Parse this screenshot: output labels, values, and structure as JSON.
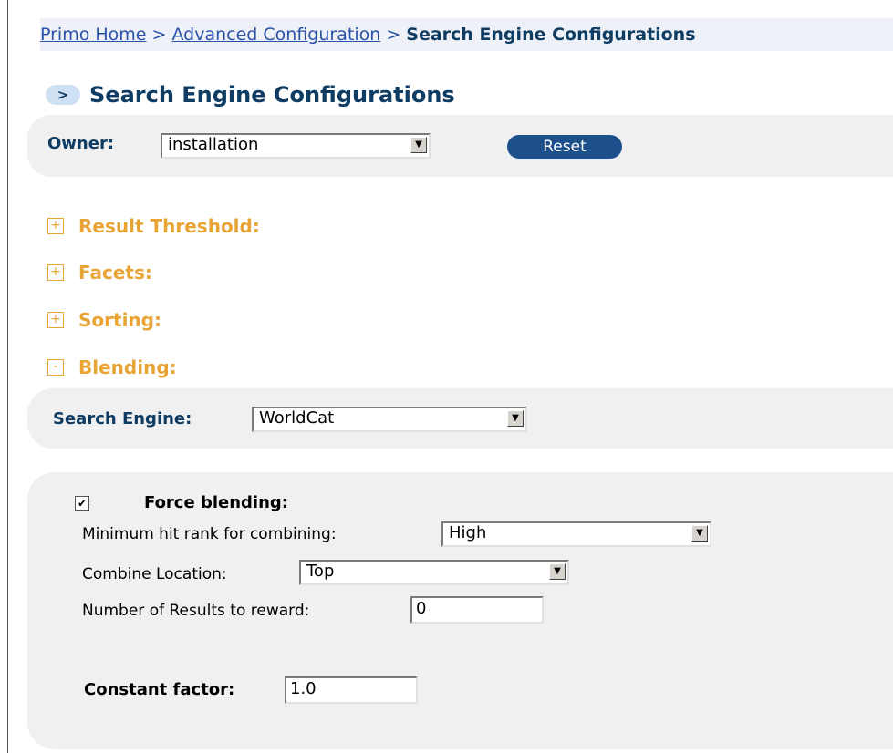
{
  "breadcrumb": {
    "home": "Primo Home",
    "sep1": ">",
    "advanced": "Advanced Configuration",
    "sep2": ">",
    "current": "Search Engine Configurations"
  },
  "title": {
    "bullet": ">",
    "text": "Search Engine Configurations"
  },
  "owner": {
    "label": "Owner:",
    "value": "installation",
    "reset_label": "Reset"
  },
  "sections": [
    {
      "toggle": "+",
      "title": "Result Threshold:"
    },
    {
      "toggle": "+",
      "title": "Facets:"
    },
    {
      "toggle": "+",
      "title": "Sorting:"
    },
    {
      "toggle": "-",
      "title": "Blending:"
    }
  ],
  "search_engine": {
    "label": "Search Engine:",
    "value": "WorldCat"
  },
  "blending": {
    "force_label": "Force blending:",
    "force_checked": "☑",
    "min_rank_label": "Minimum hit rank for combining:",
    "min_rank_value": "High",
    "location_label": "Combine Location:",
    "location_value": "Top",
    "reward_label": "Number of Results to reward:",
    "reward_value": "0",
    "constant_label": "Constant factor:",
    "constant_value": "1.0"
  },
  "colors": {
    "navy": "#0e3c63",
    "link": "#2a52a8",
    "orange": "#e8a435",
    "panel": "#f0f0f0",
    "button": "#1d4f8a"
  }
}
